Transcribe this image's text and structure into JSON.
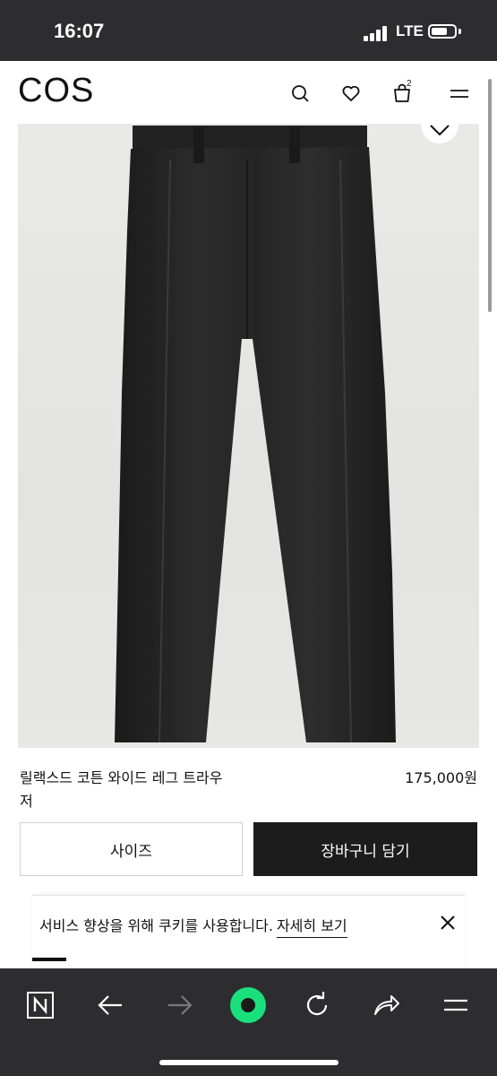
{
  "status_bar": {
    "time": "16:07",
    "network": "LTE"
  },
  "header": {
    "logo": "COS",
    "bag_count": "2",
    "icons": [
      "search-icon",
      "heart-icon",
      "bag-icon",
      "menu-icon"
    ]
  },
  "product": {
    "name": "릴랙스드 코튼 와이드 레그 트라우저",
    "price": "175,000원",
    "size_button": "사이즈",
    "cart_button": "장바구니 담기"
  },
  "cookie_banner": {
    "text": "서비스 향상을 위해 쿠키를 사용합니다.",
    "link": "자세히 보기"
  },
  "toolbar": {
    "icons": [
      "naver-home-icon",
      "back-arrow-icon",
      "forward-arrow-icon",
      "green-record-icon",
      "refresh-icon",
      "share-icon",
      "menu-icon"
    ]
  },
  "colors": {
    "status_bar_bg": "#2d2d2f",
    "cart_button_bg": "#1c1c1c",
    "record_button": "#19e07c"
  }
}
